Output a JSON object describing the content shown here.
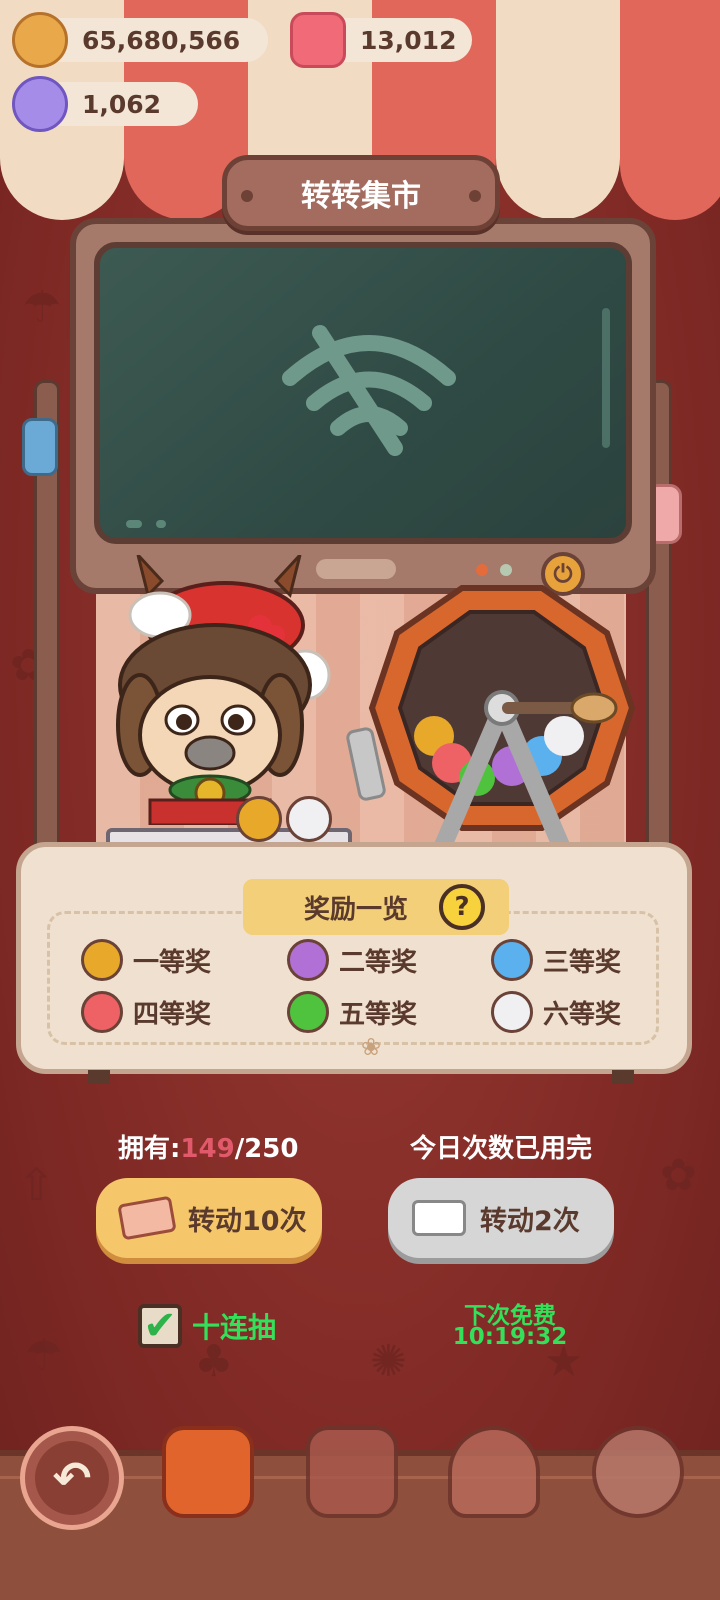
{
  "currency": {
    "cookies": "65,680,566",
    "candles": "13,012",
    "crystals": "1,062"
  },
  "title": "转转集市",
  "rewards": {
    "header": "奖励一览",
    "help_icon": "?",
    "prizes": [
      {
        "label": "一等奖",
        "color": "#e8a92a"
      },
      {
        "label": "二等奖",
        "color": "#b170d6"
      },
      {
        "label": "三等奖",
        "color": "#5ab1ee"
      },
      {
        "label": "四等奖",
        "color": "#ee6165"
      },
      {
        "label": "五等奖",
        "color": "#4fc23e"
      },
      {
        "label": "六等奖",
        "color": "#f0f0f2"
      }
    ]
  },
  "spin": {
    "owned_label": "拥有:",
    "owned_count": "149",
    "owned_max": "/250",
    "spin10_label": "转动10次",
    "ten_draw_label": "十连抽",
    "ten_draw_checked": true,
    "daily_status": "今日次数已用完",
    "spin_ad_label": "转动2次",
    "next_free_label": "下次免费",
    "next_free_timer": "10:19:32"
  },
  "colors": {
    "accent_gold": "#f5c76a",
    "timer_green": "#33e05a",
    "owned_count_color": "#e05a6b"
  }
}
